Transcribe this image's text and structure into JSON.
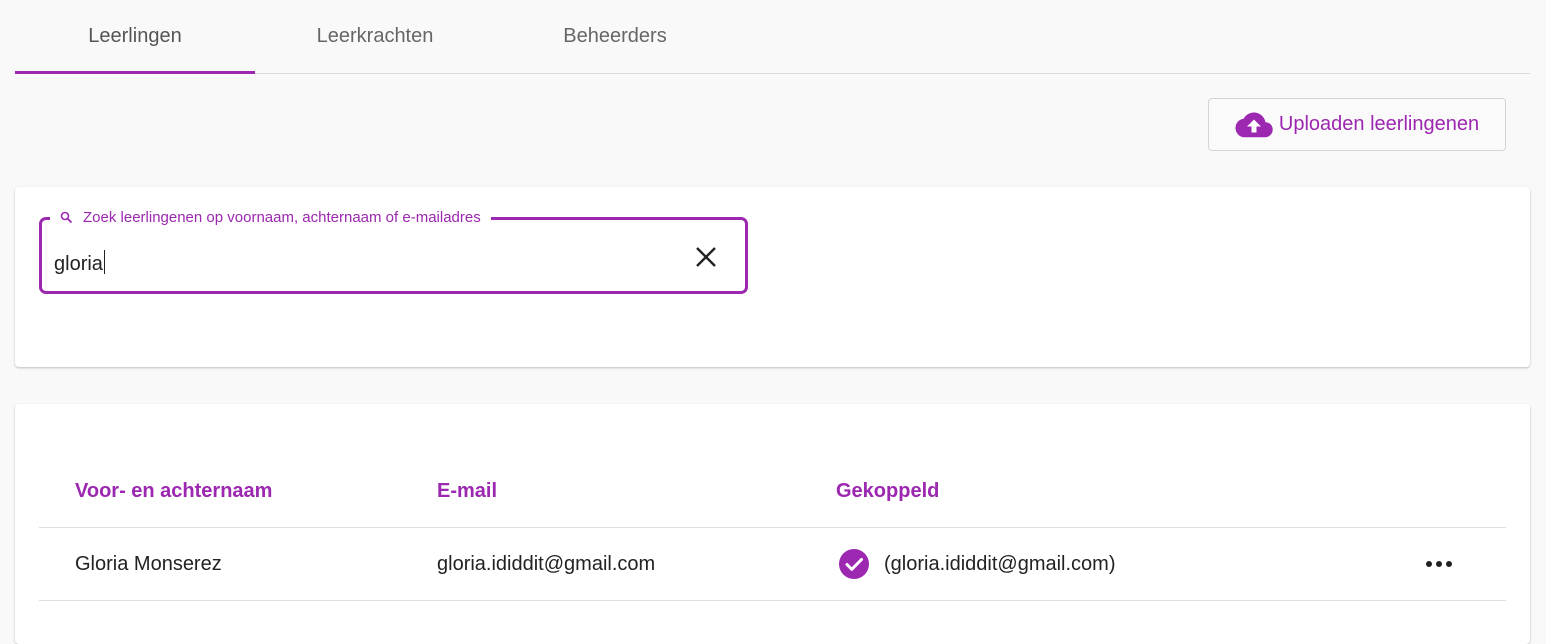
{
  "tabs": [
    {
      "label": "Leerlingen",
      "active": true
    },
    {
      "label": "Leerkrachten",
      "active": false
    },
    {
      "label": "Beheerders",
      "active": false
    }
  ],
  "toolbar": {
    "upload_label": "Uploaden leerlingenen",
    "upload_icon": "cloud-upload-icon"
  },
  "search": {
    "label": "Zoek leerlingenen op voornaam, achternaam of e-mailadres",
    "value": "gloria",
    "clear_icon": "close-icon"
  },
  "table": {
    "headers": [
      "Voor- en achternaam",
      "E-mail",
      "Gekoppeld"
    ],
    "rows": [
      {
        "name": "Gloria Monserez",
        "email": "gloria.ididdit@gmail.com",
        "linked": "(gloria.ididdit@gmail.com)",
        "linked_icon": "check-circle-icon",
        "actions_icon": "more-horizontal-icon"
      }
    ]
  },
  "colors": {
    "accent": "#9c27b0",
    "background": "#f9f9f9",
    "text": "#212121",
    "tab_text": "#666666"
  }
}
